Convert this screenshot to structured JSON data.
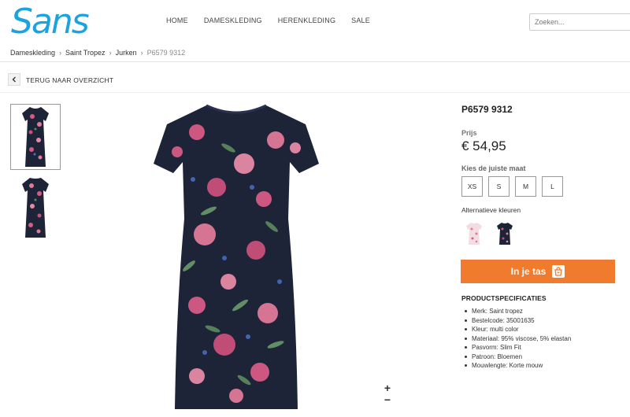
{
  "brand": {
    "logo_text": "Sans",
    "color": "#1aa3dc"
  },
  "nav": [
    {
      "label": "HOME"
    },
    {
      "label": "DAMESKLEDING"
    },
    {
      "label": "HERENKLEDING"
    },
    {
      "label": "SALE"
    }
  ],
  "search": {
    "placeholder": "Zoeken..."
  },
  "breadcrumb": {
    "items": [
      "Dameskleding",
      "Saint Tropez",
      "Jurken"
    ],
    "current": "P6579 9312"
  },
  "back": {
    "label": "TERUG NAAR OVERZICHT",
    "icon": "chevron-left-icon"
  },
  "product": {
    "code": "P6579 9312",
    "price_label": "Prijs",
    "price": "€ 54,95",
    "size_label": "Kies de juiste maat",
    "sizes": [
      "XS",
      "S",
      "M",
      "L"
    ],
    "alt_colors_label": "Alternatieve kleuren",
    "alt_colors": [
      "light-pink",
      "navy"
    ],
    "cart_label": "In je tas",
    "cart_icon": "shopping-bag-icon",
    "accent_color": "#f07a2e"
  },
  "specs": {
    "title": "PRODUCTSPECIFICATIES",
    "items": [
      "Merk: Saint tropez",
      "Bestelcode: 35001635",
      "Kleur: multi color",
      "Materiaal: 95% viscose, 5% elastan",
      "Pasvorm: Slim Fit",
      "Patroon: Bloemen",
      "Mouwlengte: Korte mouw"
    ]
  },
  "zoom": {
    "in": "+",
    "out": "−"
  }
}
